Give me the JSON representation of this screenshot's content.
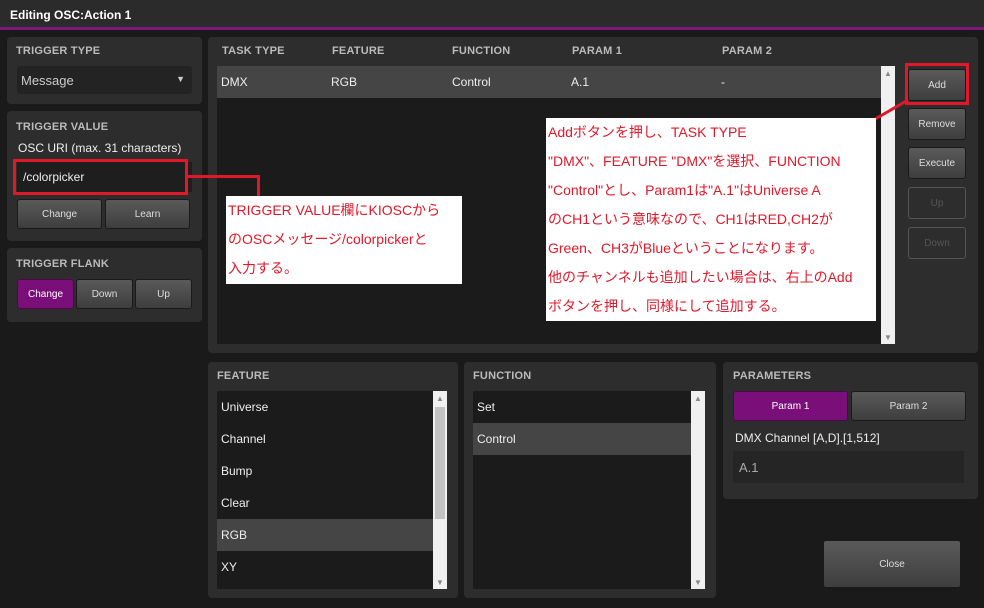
{
  "window": {
    "title": "Editing OSC:Action 1"
  },
  "trigger_type": {
    "label": "TRIGGER TYPE",
    "selected": "Message",
    "arrow": "▼"
  },
  "trigger_value": {
    "label": "TRIGGER VALUE",
    "field_label": "OSC URI (max. 31 characters)",
    "value": "/colorpicker",
    "change": "Change",
    "learn": "Learn"
  },
  "trigger_flank": {
    "label": "TRIGGER FLANK",
    "options": [
      "Change",
      "Down",
      "Up"
    ],
    "active": "Change"
  },
  "tasks": {
    "headers": [
      "TASK TYPE",
      "FEATURE",
      "FUNCTION",
      "PARAM 1",
      "PARAM 2"
    ],
    "rows": [
      {
        "task_type": "DMX",
        "feature": "RGB",
        "function": "Control",
        "param1": "A.1",
        "param2": "-"
      }
    ]
  },
  "side_buttons": {
    "add": "Add",
    "remove": "Remove",
    "execute": "Execute",
    "up": "Up",
    "down": "Down"
  },
  "feature": {
    "label": "FEATURE",
    "items": [
      "Universe",
      "Channel",
      "Bump",
      "Clear",
      "RGB",
      "XY"
    ],
    "selected": "RGB"
  },
  "function": {
    "label": "FUNCTION",
    "items": [
      "Set",
      "Control"
    ],
    "selected": "Control"
  },
  "parameters": {
    "label": "PARAMETERS",
    "tabs": [
      "Param 1",
      "Param 2"
    ],
    "active": "Param 1",
    "field_label": "DMX Channel [A,D].[1,512]",
    "value": "A.1"
  },
  "close": "Close",
  "annotations": {
    "left": [
      "TRIGGER VALUE欄にKIOSCから",
      "のOSCメッセージ/colorpickerと",
      "入力する。"
    ],
    "right": [
      "Addボタンを押し、TASK TYPE",
      "\"DMX\"、FEATURE \"DMX\"を選択、FUNCTION",
      "\"Control\"とし、Param1は\"A.1\"はUniverse A",
      "のCH1という意味なので、CH1はRED,CH2が",
      "Green、CH3がBlueということになります。",
      "他のチャンネルも追加したい場合は、右上のAdd",
      "ボタンを押し、同様にして追加する。"
    ]
  },
  "colors": {
    "accent": "#7a0f7a",
    "annotation": "#e0182a",
    "panel": "#2d2d2d",
    "background": "#1a1a1a"
  }
}
